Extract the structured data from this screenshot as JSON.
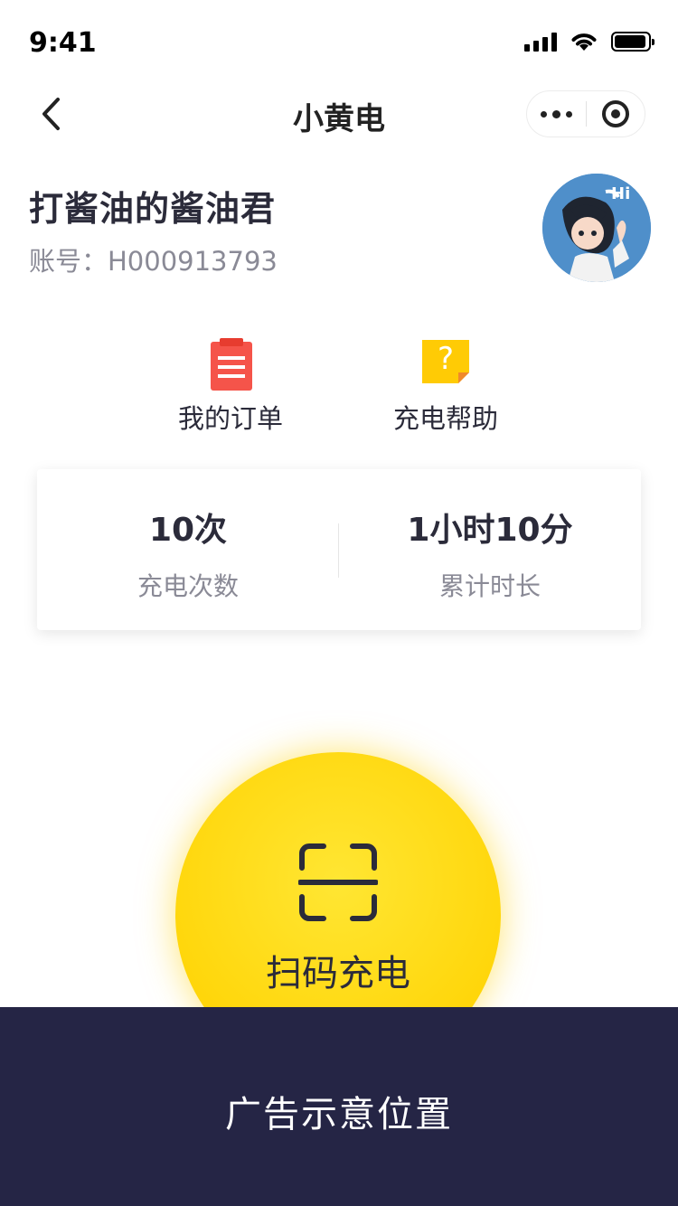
{
  "status_bar": {
    "time": "9:41"
  },
  "nav": {
    "title": "小黄电"
  },
  "profile": {
    "name": "打酱油的酱油君",
    "account": "账号：H000913793"
  },
  "actions": [
    {
      "label": "我的订单",
      "icon": "order-list-icon",
      "color": "#f5544a"
    },
    {
      "label": "充电帮助",
      "icon": "help-question-icon",
      "color": "#ffcb05"
    }
  ],
  "stats": {
    "count": {
      "value": "10次",
      "label": "充电次数"
    },
    "duration": {
      "value": "1小时10分",
      "label": "累计时长"
    }
  },
  "scan": {
    "label": "扫码充电",
    "color": "#ffd60a"
  },
  "ad": {
    "text": "广告示意位置",
    "background": "#252545"
  }
}
